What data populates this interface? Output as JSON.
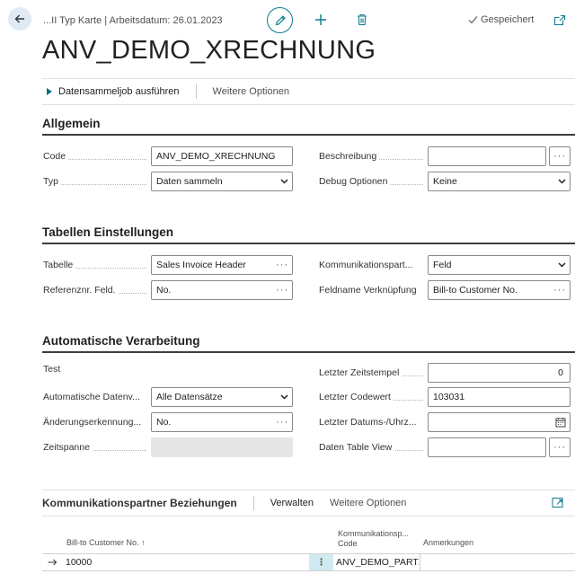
{
  "header": {
    "breadcrumb": "...II Typ Karte | Arbeitsdatum: 26.01.2023",
    "save_status": "Gespeichert"
  },
  "page": {
    "title": "ANV_DEMO_XRECHNUNG"
  },
  "actions": {
    "run_job": "Datensammeljob ausführen",
    "more_options": "Weitere Optionen"
  },
  "general": {
    "title": "Allgemein",
    "code_label": "Code",
    "code_value": "ANV_DEMO_XRECHNUNG",
    "type_label": "Typ",
    "type_value": "Daten sammeln",
    "description_label": "Beschreibung",
    "description_value": "",
    "debug_label": "Debug Optionen",
    "debug_value": "Keine"
  },
  "table_settings": {
    "title": "Tabellen Einstellungen",
    "table_label": "Tabelle",
    "table_value": "Sales Invoice Header",
    "refno_label": "Referenznr. Feld.",
    "refno_value": "No.",
    "partner_label": "Kommunikationspart...",
    "partner_value": "Feld",
    "link_label": "Feldname Verknüpfung",
    "link_value": "Bill-to Customer No."
  },
  "auto_processing": {
    "title": "Automatische Verarbeitung",
    "test_label": "Test",
    "auto_data_label": "Automatische Datenv...",
    "auto_data_value": "Alle Datensätze",
    "change_label": "Änderungserkennung...",
    "change_value": "No.",
    "timespan_label": "Zeitspanne",
    "timespan_value": "",
    "last_timestamp_label": "Letzter Zeitstempel",
    "last_timestamp_value": "0",
    "last_code_label": "Letzter Codewert",
    "last_code_value": "103031",
    "last_datetime_label": "Letzter Datums-/Uhrz...",
    "last_datetime_value": "",
    "table_view_label": "Daten Table View",
    "table_view_value": ""
  },
  "relations_part": {
    "title": "Kommunikationspartner Beziehungen",
    "manage": "Verwalten",
    "more_options": "Weitere Optionen",
    "columns": {
      "customer_no": "Bill-to Customer No. ↑",
      "partner_code_line1": "Kommunikationsp...",
      "partner_code_line2": "Code",
      "remarks": "Anmerkungen"
    },
    "rows": [
      {
        "customer_no": "10000",
        "partner_code": "ANV_DEMO_PART...",
        "remarks": ""
      }
    ]
  },
  "icons": {
    "back": "arrow-left-icon",
    "edit": "pencil-icon",
    "new": "plus-icon",
    "delete": "trash-icon",
    "saved": "checkmark-icon",
    "popout": "open-in-new-window-icon"
  },
  "colors": {
    "accent": "#0f7b8c",
    "back_bg": "#dfeaf4",
    "row_menu_bg": "#cfeaf0"
  }
}
